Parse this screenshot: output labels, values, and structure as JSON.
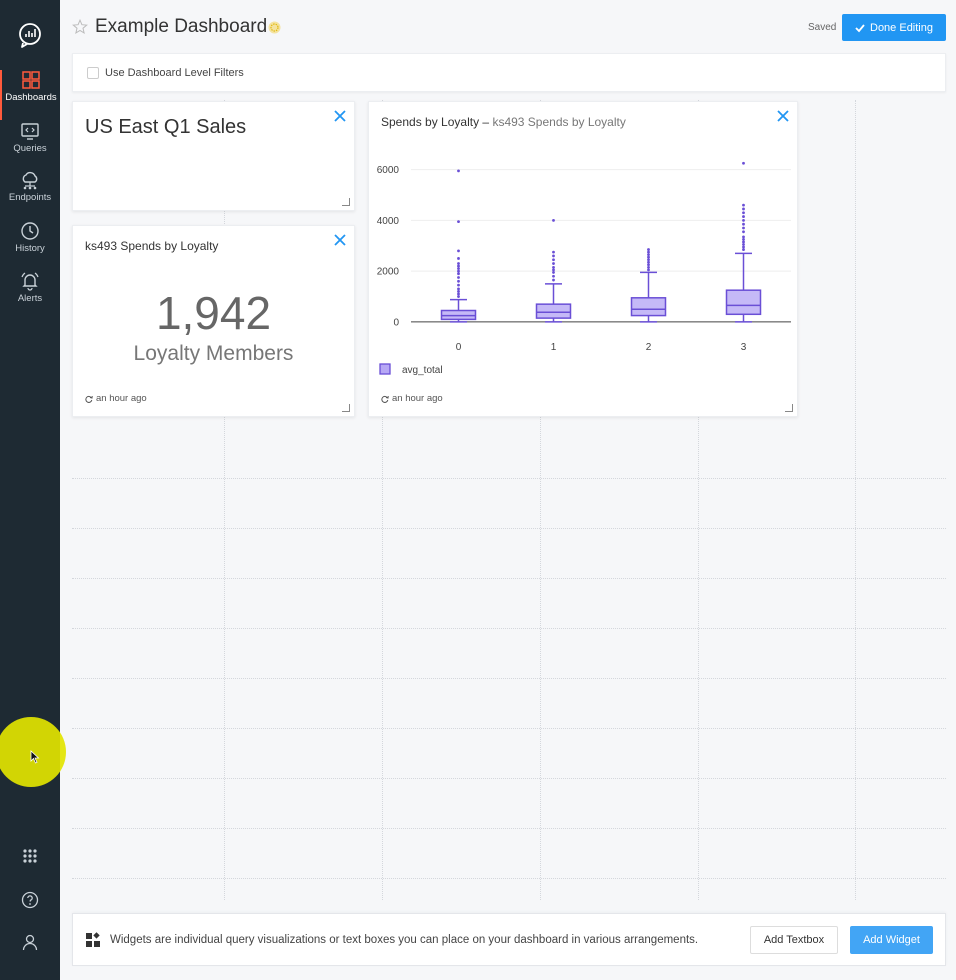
{
  "sidebar": {
    "items": [
      {
        "label": "Dashboards",
        "icon": "dashboards-icon",
        "active": true
      },
      {
        "label": "Queries",
        "icon": "queries-icon"
      },
      {
        "label": "Endpoints",
        "icon": "endpoints-icon"
      },
      {
        "label": "History",
        "icon": "history-icon"
      },
      {
        "label": "Alerts",
        "icon": "alerts-icon"
      }
    ],
    "bottom": [
      "apps-grid-icon",
      "help-icon",
      "user-icon"
    ]
  },
  "header": {
    "title": "Example Dashboard",
    "saved_text": "Saved",
    "done_label": "Done Editing"
  },
  "filter": {
    "label": "Use Dashboard Level Filters"
  },
  "widgets": {
    "textbox": {
      "title": "US East Q1 Sales"
    },
    "counter": {
      "title": "ks493 Spends by Loyalty",
      "value": "1,942",
      "label": "Loyalty Members",
      "refresh": "an hour ago"
    },
    "chart": {
      "title": "Spends by Loyalty",
      "separator": "–",
      "subtitle": "ks493 Spends by Loyalty",
      "refresh": "an hour ago"
    }
  },
  "chart_data": {
    "type": "box",
    "title": "Spends by Loyalty",
    "categories": [
      "0",
      "1",
      "2",
      "3"
    ],
    "yticks": [
      0,
      2000,
      4000,
      6000
    ],
    "ylim": [
      -200,
      6300
    ],
    "series": [
      {
        "name": "avg_total",
        "boxes": [
          {
            "min": 0,
            "q1": 100,
            "median": 250,
            "q3": 450,
            "max": 880,
            "outliers": [
              1000,
              1100,
              1200,
              1300,
              1450,
              1600,
              1750,
              1900,
              2000,
              2100,
              2200,
              2300,
              2500,
              2800,
              3950,
              5950
            ]
          },
          {
            "min": 0,
            "q1": 150,
            "median": 380,
            "q3": 700,
            "max": 1500,
            "outliers": [
              1650,
              1800,
              1950,
              2050,
              2150,
              2300,
              2450,
              2600,
              2750,
              4000
            ]
          },
          {
            "min": 0,
            "q1": 250,
            "median": 500,
            "q3": 950,
            "max": 1950,
            "outliers": [
              2050,
              2150,
              2250,
              2350,
              2450,
              2550,
              2650,
              2750,
              2850
            ]
          },
          {
            "min": 0,
            "q1": 300,
            "median": 650,
            "q3": 1250,
            "max": 2700,
            "outliers": [
              2850,
              2950,
              3050,
              3150,
              3250,
              3350,
              3550,
              3700,
              3850,
              4000,
              4150,
              4300,
              4450,
              4600,
              6250
            ]
          }
        ]
      }
    ],
    "legend": "bottom-left",
    "grid": true,
    "colors": {
      "fill": "#b7a8f5",
      "stroke": "#6a4fd6"
    }
  },
  "bottom_bar": {
    "text": "Widgets are individual query visualizations or text boxes you can place on your dashboard in various arrangements.",
    "add_textbox": "Add Textbox",
    "add_widget": "Add Widget"
  },
  "colors": {
    "primary": "#2196f3",
    "sidebar": "#1e2a33",
    "active": "#ff5a3c"
  }
}
